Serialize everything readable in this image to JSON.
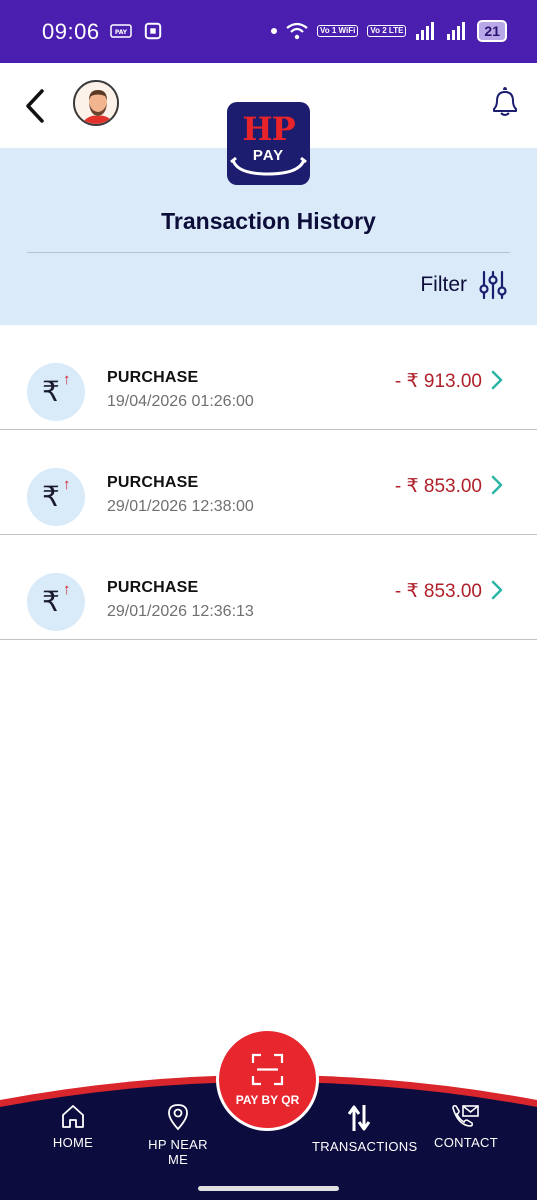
{
  "status_bar": {
    "time": "09:06",
    "network_badges": [
      "Vo 1 WiFi",
      "Vo 2 LTE"
    ],
    "battery": "21"
  },
  "header": {
    "back_icon": "back-arrow-icon",
    "avatar_icon": "user-avatar",
    "bell_icon": "bell-icon"
  },
  "logo": {
    "brand_main": "HP",
    "brand_sub": "PAY"
  },
  "page": {
    "title": "Transaction History",
    "filter_label": "Filter"
  },
  "transactions": [
    {
      "type": "PURCHASE",
      "datetime": "19/04/2026 01:26:00",
      "amount": "- ₹ 913.00"
    },
    {
      "type": "PURCHASE",
      "datetime": "29/01/2026 12:38:00",
      "amount": "- ₹ 853.00"
    },
    {
      "type": "PURCHASE",
      "datetime": "29/01/2026 12:36:13",
      "amount": "- ₹ 853.00"
    }
  ],
  "bottom_nav": {
    "home": "HOME",
    "near_me": "HP NEAR ME",
    "pay_by_qr": "PAY BY QR",
    "transactions": "TRANSACTIONS",
    "contact": "CONTACT"
  },
  "colors": {
    "status_bar": "#4a1fb0",
    "hero_bg": "#daeaf8",
    "nav_bg": "#0c0c3e",
    "accent_red": "#e8262e",
    "amount_red": "#b0202a",
    "chevron_teal": "#2bb5a6"
  }
}
